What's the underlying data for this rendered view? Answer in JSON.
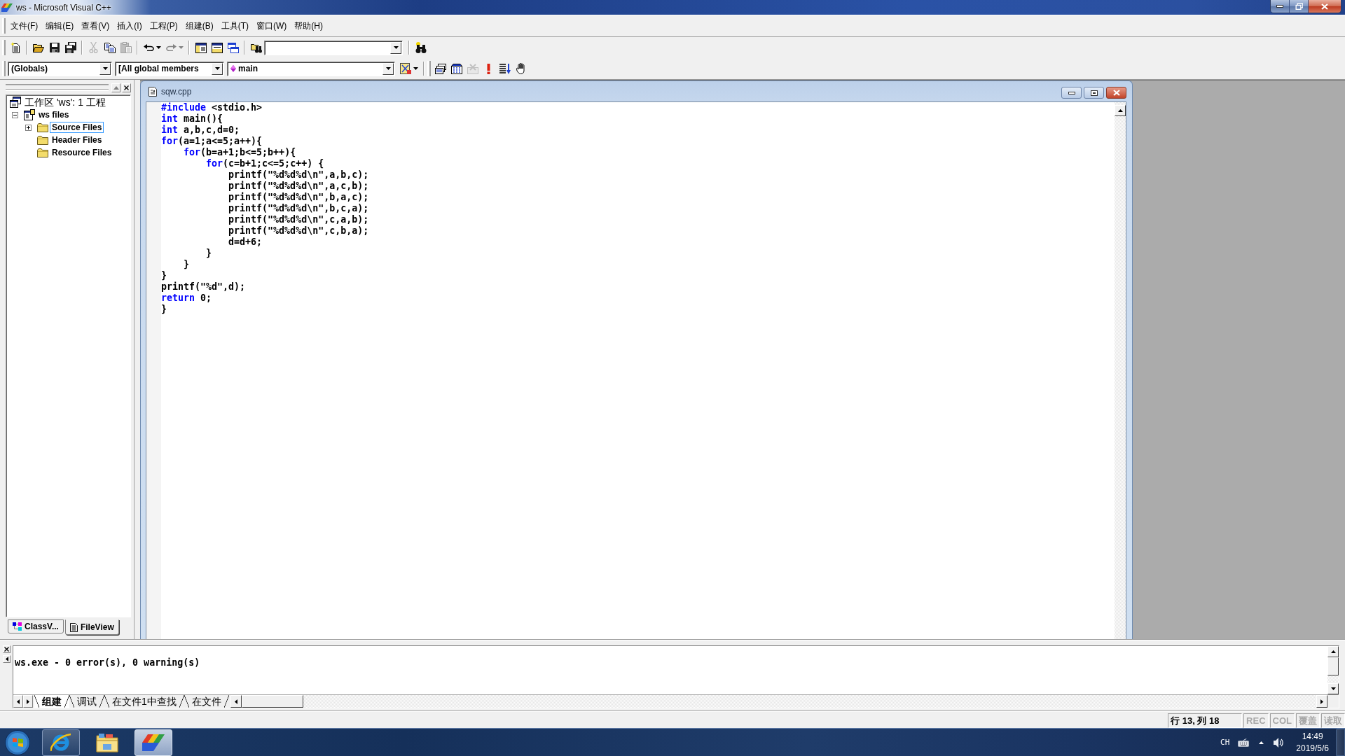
{
  "window": {
    "title": "ws - Microsoft Visual C++"
  },
  "menu": [
    "文件(F)",
    "编辑(E)",
    "查看(V)",
    "插入(I)",
    "工程(P)",
    "组建(B)",
    "工具(T)",
    "窗口(W)",
    "帮助(H)"
  ],
  "standard_toolbar": {
    "items": [
      {
        "kind": "button",
        "disabled": false
      },
      {
        "kind": "separator"
      },
      {
        "kind": "button",
        "disabled": false
      },
      {
        "kind": "button",
        "disabled": false
      },
      {
        "kind": "button",
        "disabled": false
      },
      {
        "kind": "separator"
      },
      {
        "kind": "button",
        "disabled": true
      },
      {
        "kind": "button",
        "disabled": false
      },
      {
        "kind": "button",
        "disabled": true
      },
      {
        "kind": "separator"
      },
      {
        "kind": "split",
        "disabled": false
      },
      {
        "kind": "split",
        "disabled": true
      },
      {
        "kind": "separator"
      },
      {
        "kind": "button",
        "disabled": false
      },
      {
        "kind": "button",
        "disabled": false
      },
      {
        "kind": "button",
        "disabled": false
      },
      {
        "kind": "separator"
      },
      {
        "kind": "button",
        "disabled": false
      },
      {
        "kind": "combo"
      },
      {
        "kind": "separator"
      },
      {
        "kind": "button",
        "disabled": false
      }
    ]
  },
  "wizard_bar": {
    "combos": [
      {
        "value": "(Globals)"
      },
      {
        "value": "[All global members"
      },
      {
        "value": "main"
      }
    ],
    "action": {
      "disabled": false
    }
  },
  "build_toolbar": {
    "buttons": [
      {
        "disabled": false
      },
      {
        "disabled": false
      },
      {
        "disabled": true
      },
      {
        "disabled": false
      },
      {
        "disabled": false
      },
      {
        "disabled": false
      }
    ]
  },
  "workspace": {
    "tree": [
      {
        "label": "工作区 'ws': 1 工程",
        "selected": false,
        "children": [
          {
            "label": "ws files",
            "selected": false,
            "expanded": true,
            "children": [
              {
                "label": "Source Files",
                "selected": true,
                "expanded": false
              },
              {
                "label": "Header Files",
                "selected": false
              },
              {
                "label": "Resource Files",
                "selected": false
              }
            ]
          }
        ]
      }
    ],
    "tabs": [
      {
        "label": "ClassV...",
        "selected": false
      },
      {
        "label": "FileView",
        "selected": true
      }
    ]
  },
  "editor": {
    "title": "sqw.cpp",
    "lines": [
      [
        {
          "kind": "keyword",
          "text": "#include"
        },
        {
          "kind": "text",
          "text": " <stdio.h>"
        }
      ],
      [
        {
          "kind": "keyword",
          "text": "int"
        },
        {
          "kind": "text",
          "text": " main(){"
        }
      ],
      [
        {
          "kind": "keyword",
          "text": "int"
        },
        {
          "kind": "text",
          "text": " a,b,c,d=0;"
        }
      ],
      [
        {
          "kind": "keyword",
          "text": "for"
        },
        {
          "kind": "text",
          "text": "(a=1;a<=5;a++){"
        }
      ],
      [
        {
          "kind": "keyword",
          "text": "    for"
        },
        {
          "kind": "text",
          "text": "(b=a+1;b<=5;b++){"
        }
      ],
      [
        {
          "kind": "keyword",
          "text": "        for"
        },
        {
          "kind": "text",
          "text": "(c=b+1;c<=5;c++) {"
        }
      ],
      [
        {
          "kind": "text",
          "text": "            printf(\"%d%d%d\\n\",a,b,c);"
        }
      ],
      [
        {
          "kind": "text",
          "text": "            printf(\"%d%d%d\\n\",a,c,b);"
        }
      ],
      [
        {
          "kind": "text",
          "text": "            printf(\"%d%d%d\\n\",b,a,c);"
        }
      ],
      [
        {
          "kind": "text",
          "text": "            printf(\"%d%d%d\\n\",b,c,a);"
        }
      ],
      [
        {
          "kind": "text",
          "text": "            printf(\"%d%d%d\\n\",c,a,b);"
        }
      ],
      [
        {
          "kind": "text",
          "text": "            printf(\"%d%d%d\\n\",c,b,a);"
        }
      ],
      [
        {
          "kind": "text",
          "text": "            d=d+6;"
        }
      ],
      [
        {
          "kind": "text",
          "text": "        }"
        }
      ],
      [
        {
          "kind": "text",
          "text": "    }"
        }
      ],
      [
        {
          "kind": "text",
          "text": "}"
        }
      ],
      [
        {
          "kind": "text",
          "text": "printf(\"%d\",d);"
        }
      ],
      [
        {
          "kind": "keyword",
          "text": "return"
        },
        {
          "kind": "text",
          "text": " 0;"
        }
      ],
      [
        {
          "kind": "text",
          "text": "}"
        }
      ]
    ]
  },
  "output": {
    "lines": [
      "ws.exe - 0 error(s), 0 warning(s)"
    ],
    "tabs": [
      {
        "label": "组建",
        "selected": true
      },
      {
        "label": "调试",
        "selected": false
      },
      {
        "label": "在文件1中查找",
        "selected": false
      },
      {
        "label": "在文件",
        "selected": false
      }
    ]
  },
  "status_bar": {
    "position": "行 13, 列 18",
    "indicators": [
      {
        "label": "REC",
        "active": false
      },
      {
        "label": "COL",
        "active": false
      },
      {
        "label": "覆盖",
        "active": false
      },
      {
        "label": "读取",
        "active": false
      }
    ]
  },
  "taskbar": {
    "apps": [
      {
        "running": true,
        "selected": false
      },
      {
        "running": false,
        "selected": false
      },
      {
        "running": true,
        "selected": true
      }
    ],
    "language": "CH",
    "time": "14:49",
    "date": "2019/5/6"
  }
}
